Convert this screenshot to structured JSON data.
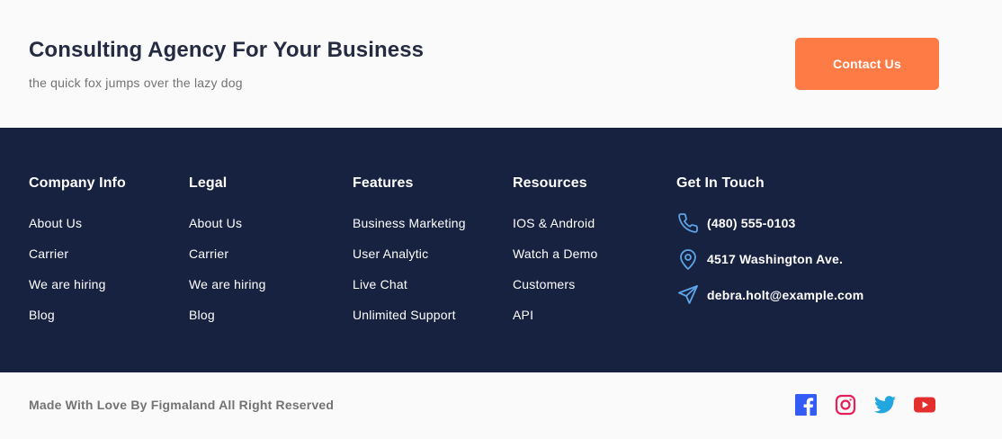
{
  "header": {
    "title": "Consulting Agency For Your Business",
    "subtitle": "the quick fox jumps over the lazy dog",
    "contact_button": "Contact Us"
  },
  "footer": {
    "columns": [
      {
        "title": "Company Info",
        "links": [
          "About Us",
          "Carrier",
          "We are hiring",
          "Blog"
        ]
      },
      {
        "title": "Legal",
        "links": [
          "About Us",
          "Carrier",
          "We are hiring",
          "Blog"
        ]
      },
      {
        "title": "Features",
        "links": [
          "Business Marketing",
          "User Analytic",
          "Live Chat",
          "Unlimited Support"
        ]
      },
      {
        "title": "Resources",
        "links": [
          "IOS & Android",
          "Watch a Demo",
          "Customers",
          "API"
        ]
      }
    ],
    "contact": {
      "title": "Get In Touch",
      "phone": "(480) 555-0103",
      "address": "4517 Washington Ave.",
      "email": "debra.holt@example.com",
      "icon_color": "#5ea5e8"
    }
  },
  "bottom_bar": {
    "copyright": "Made With Love By Figmaland All Right Reserved",
    "socials": [
      {
        "icon": "facebook-icon",
        "color": "#335bf5"
      },
      {
        "icon": "instagram-icon",
        "color": "#e51f5a"
      },
      {
        "icon": "twitter-icon",
        "color": "#21a6df"
      },
      {
        "icon": "youtube-icon",
        "color": "#e42e2e"
      }
    ]
  },
  "colors": {
    "accent": "#ff7b45",
    "dark_bg": "#172140",
    "heading": "#252b42",
    "muted": "#737373"
  }
}
